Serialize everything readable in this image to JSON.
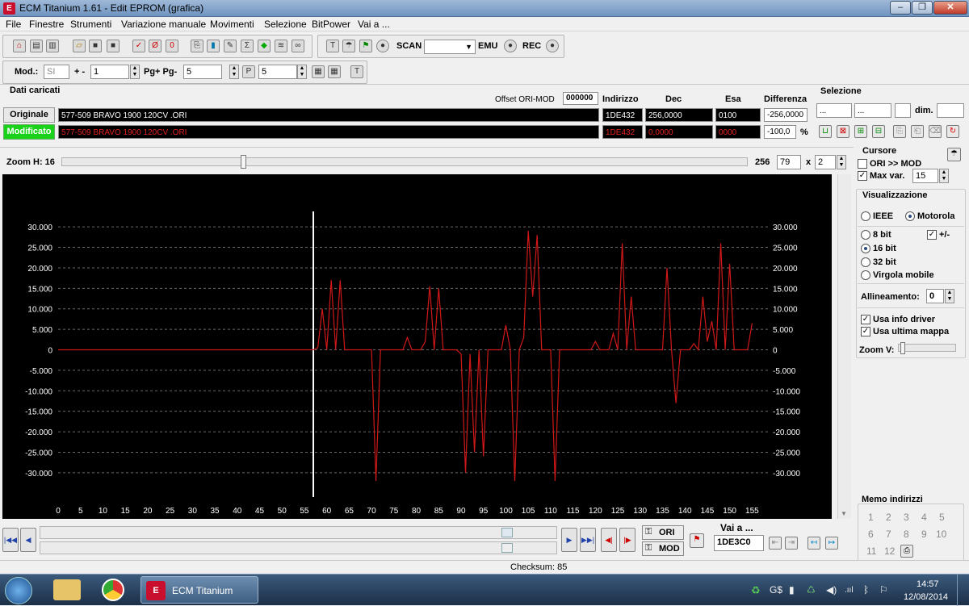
{
  "window": {
    "title": "ECM Titanium 1.61 - Edit EPROM (grafica)",
    "icon": "ecm-app-icon",
    "minimize": "–",
    "restore": "❐",
    "close": "✕"
  },
  "menu": [
    "File",
    "Finestre",
    "Strumenti",
    "Variazione manuale",
    "Movimenti",
    "Selezione",
    "BitPower",
    "Vai a ..."
  ],
  "toolbar": {
    "scan": "SCAN",
    "emu": "EMU",
    "rec": "REC"
  },
  "modbar": {
    "mod_label": "Mod.:",
    "mod_value": "SI",
    "pm_label": "+ -",
    "pm_value": "1",
    "pg_label": "Pg+ Pg-",
    "pg_value": "5",
    "p_value": "5"
  },
  "dati": {
    "title": "Dati caricati",
    "offset_label": "Offset ORI-MOD",
    "offset_value": "000000",
    "col_indirizzo": "Indirizzo",
    "col_dec": "Dec",
    "col_esa": "Esa",
    "col_diff": "Differenza",
    "originale": {
      "label": "Originale",
      "file": "577-509 BRAVO 1900 120CV .ORI",
      "indirizzo": "1DE432",
      "dec": "256,0000",
      "esa": "0100",
      "diff": "-256,0000"
    },
    "modificato": {
      "label": "Modificato",
      "file": "577-509 BRAVO 1900 120CV .ORI",
      "indirizzo": "1DE432",
      "dec": "0,0000",
      "esa": "0000",
      "diff": "-100,0",
      "pct": "%"
    }
  },
  "selezione": {
    "title": "Selezione",
    "f1": "...",
    "f2": "...",
    "dim_label": "dim."
  },
  "zoom": {
    "label": "Zoom H: 16",
    "val256": "256",
    "val79": "79",
    "x": "x",
    "mult": "2"
  },
  "cursore": {
    "title": "Cursore",
    "ori_mod": "ORI >> MOD",
    "max_var": "Max var.",
    "max_var_value": "15"
  },
  "visual": {
    "title": "Visualizzazione",
    "ieee": "IEEE",
    "motorola": "Motorola",
    "bit8": "8 bit",
    "pm": "+/-",
    "bit16": "16 bit",
    "bit32": "32 bit",
    "virgola": "Virgola mobile",
    "allineamento": "Allineamento:",
    "allineamento_value": "0",
    "usa_info": "Usa info driver",
    "usa_ultima": "Usa ultima mappa",
    "zoom_v": "Zoom V:"
  },
  "memo": {
    "title": "Memo indirizzi",
    "nums": [
      "1",
      "2",
      "3",
      "4",
      "5",
      "6",
      "7",
      "8",
      "9",
      "10",
      "11",
      "12"
    ]
  },
  "bottom": {
    "ori": "ORI",
    "mod": "MOD",
    "vai_a": "Vai a ...",
    "vai_value": "1DE3C0",
    "checksum": "Checksum: 85"
  },
  "taskbar": {
    "app": "ECM Titanium",
    "time": "14:57",
    "date": "12/08/2014"
  },
  "chart_data": {
    "type": "line",
    "x_ticks": [
      0,
      5,
      10,
      15,
      20,
      25,
      30,
      35,
      40,
      45,
      50,
      55,
      60,
      65,
      70,
      75,
      80,
      85,
      90,
      95,
      100,
      105,
      110,
      115,
      120,
      125,
      130,
      135,
      140,
      145,
      150,
      155
    ],
    "y_ticks": [
      "30.000",
      "25.000",
      "20.000",
      "15.000",
      "10.000",
      "5.000",
      "0",
      "-5.000",
      "-10.000",
      "-15.000",
      "-20.000",
      "-25.000",
      "-30.000"
    ],
    "xlim": [
      0,
      158
    ],
    "ylim": [
      -32000,
      32000
    ],
    "cursor_x": 57,
    "series": [
      {
        "color": "#d01818",
        "points": [
          [
            0,
            0
          ],
          [
            57,
            0
          ],
          [
            58,
            500
          ],
          [
            59,
            10000
          ],
          [
            60,
            0
          ],
          [
            61,
            17000
          ],
          [
            62,
            0
          ],
          [
            63,
            17000
          ],
          [
            64,
            0
          ],
          [
            70,
            0
          ],
          [
            71,
            -32000
          ],
          [
            72,
            0
          ],
          [
            77,
            0
          ],
          [
            78,
            3000
          ],
          [
            79,
            0
          ],
          [
            81,
            0
          ],
          [
            82,
            2000
          ],
          [
            83,
            15500
          ],
          [
            84,
            0
          ],
          [
            85,
            15000
          ],
          [
            86,
            0
          ],
          [
            89,
            0
          ],
          [
            90,
            -1000
          ],
          [
            91,
            -30000
          ],
          [
            92,
            -1000
          ],
          [
            93,
            -25000
          ],
          [
            94,
            0
          ],
          [
            95,
            -26000
          ],
          [
            96,
            0
          ],
          [
            99,
            0
          ],
          [
            100,
            6000
          ],
          [
            101,
            0
          ],
          [
            102,
            -32000
          ],
          [
            103,
            0
          ],
          [
            104,
            3000
          ],
          [
            105,
            29000
          ],
          [
            106,
            13000
          ],
          [
            107,
            28000
          ],
          [
            108,
            0
          ],
          [
            110,
            0
          ],
          [
            111,
            -32000
          ],
          [
            112,
            0
          ],
          [
            119,
            0
          ],
          [
            120,
            2000
          ],
          [
            121,
            0
          ],
          [
            123,
            0
          ],
          [
            124,
            4000
          ],
          [
            125,
            0
          ],
          [
            126,
            26000
          ],
          [
            127,
            0
          ],
          [
            128,
            13000
          ],
          [
            129,
            0
          ],
          [
            135,
            0
          ],
          [
            136,
            20000
          ],
          [
            137,
            0
          ],
          [
            138,
            -13000
          ],
          [
            139,
            0
          ],
          [
            141,
            0
          ],
          [
            142,
            1500
          ],
          [
            143,
            0
          ],
          [
            144,
            13000
          ],
          [
            145,
            2000
          ],
          [
            146,
            7000
          ],
          [
            147,
            0
          ],
          [
            148,
            26000
          ],
          [
            149,
            0
          ],
          [
            150,
            21000
          ],
          [
            151,
            0
          ],
          [
            154,
            0
          ],
          [
            155,
            6500
          ]
        ]
      }
    ]
  }
}
